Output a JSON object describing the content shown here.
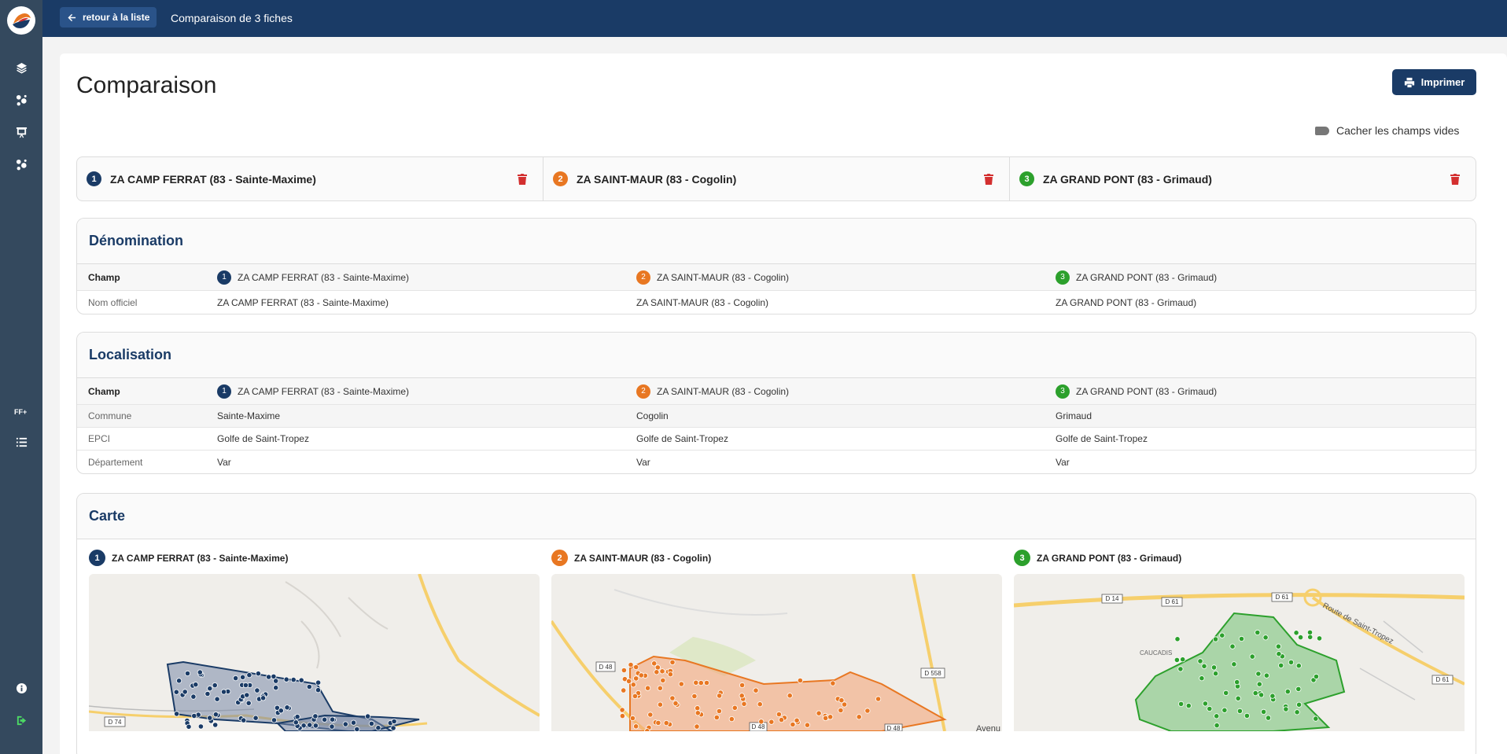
{
  "app": {
    "logo": "app-logo",
    "sidebar_icons": [
      "layers-icon",
      "location-icon",
      "presentation-icon",
      "location-icon"
    ],
    "sidebar_small_label": "FF+",
    "sidebar_list_icon": "list-icon",
    "sidebar_bottom_icons": [
      "info-icon",
      "logout-icon"
    ]
  },
  "topbar": {
    "back_label": "retour à la liste",
    "title": "Comparaison de 3 fiches"
  },
  "page": {
    "title": "Comparaison",
    "print_label": "Imprimer",
    "hide_empty_label": "Cacher les champs vides"
  },
  "fiches": [
    {
      "num": "1",
      "name": "ZA CAMP FERRAT (83 - Sainte-Maxime)",
      "color": "#1a3b66"
    },
    {
      "num": "2",
      "name": "ZA SAINT-MAUR (83 - Cogolin)",
      "color": "#e87722"
    },
    {
      "num": "3",
      "name": "ZA GRAND PONT (83 - Grimaud)",
      "color": "#2ca02c"
    }
  ],
  "sections": {
    "denomination": {
      "title": "Dénomination",
      "header_label": "Champ",
      "rows": [
        {
          "label": "Nom officiel",
          "values": [
            "ZA CAMP FERRAT (83 - Sainte-Maxime)",
            "ZA SAINT-MAUR (83 - Cogolin)",
            "ZA GRAND PONT (83 - Grimaud)"
          ]
        }
      ]
    },
    "localisation": {
      "title": "Localisation",
      "header_label": "Champ",
      "rows": [
        {
          "label": "Commune",
          "values": [
            "Sainte-Maxime",
            "Cogolin",
            "Grimaud"
          ]
        },
        {
          "label": "EPCI",
          "values": [
            "Golfe de Saint-Tropez",
            "Golfe de Saint-Tropez",
            "Golfe de Saint-Tropez"
          ]
        },
        {
          "label": "Département",
          "values": [
            "Var",
            "Var",
            "Var"
          ]
        }
      ]
    },
    "carte": {
      "title": "Carte",
      "map_labels": {
        "map1": [
          "D 74"
        ],
        "map2": [
          "D 48",
          "D 558",
          "D 48",
          "D 48",
          "Avenu"
        ],
        "map3": [
          "D 14",
          "D 61",
          "D 61",
          "D 61",
          "Route de Saint-Tropez",
          "CAUCADIS"
        ]
      }
    }
  }
}
